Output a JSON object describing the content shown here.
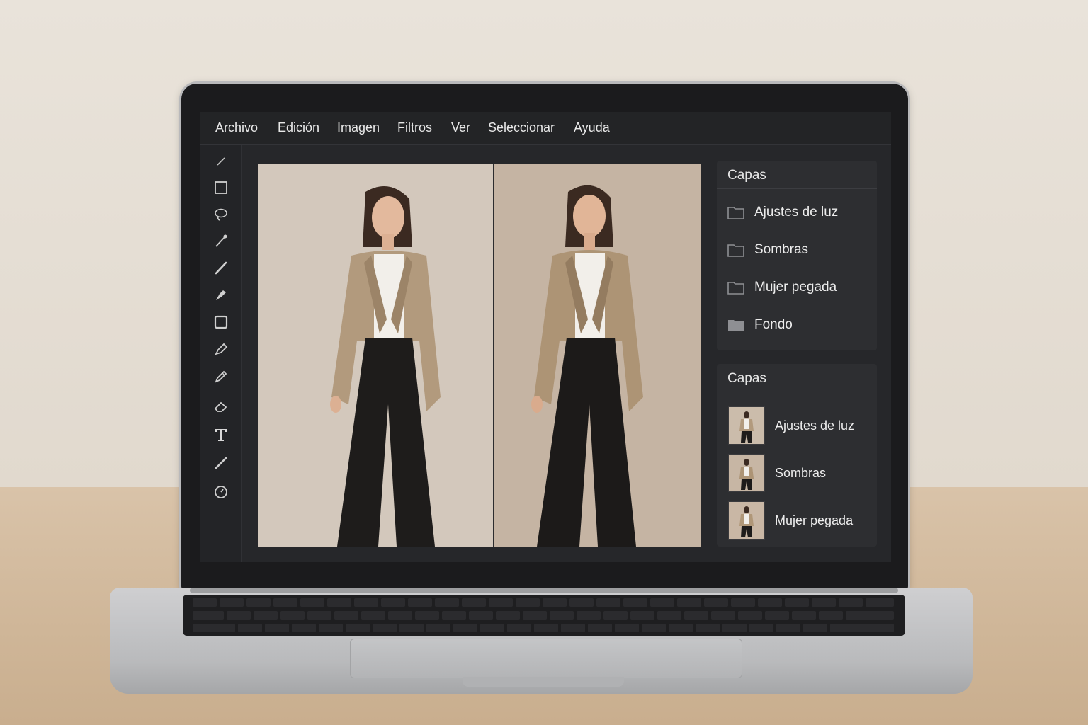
{
  "menubar": {
    "items": [
      {
        "label": "Archivo"
      },
      {
        "label": "Edición"
      },
      {
        "label": "Imagen"
      },
      {
        "label": "Filtros"
      },
      {
        "label": "Ver"
      },
      {
        "label": "Seleccionar"
      },
      {
        "label": "Ayuda"
      }
    ]
  },
  "tools": [
    {
      "icon": "line-icon"
    },
    {
      "icon": "rectangle-icon"
    },
    {
      "icon": "lasso-icon"
    },
    {
      "icon": "eyedropper-icon"
    },
    {
      "icon": "brush-icon"
    },
    {
      "icon": "pen-icon"
    },
    {
      "icon": "shape-icon"
    },
    {
      "icon": "marker-icon"
    },
    {
      "icon": "pencil-icon"
    },
    {
      "icon": "eraser-icon"
    },
    {
      "icon": "text-icon"
    },
    {
      "icon": "slash-icon"
    },
    {
      "icon": "clock-icon"
    }
  ],
  "panels": {
    "groups": {
      "title": "Capas",
      "items": [
        {
          "label": "Ajustes de luz"
        },
        {
          "label": "Sombras"
        },
        {
          "label": "Mujer pegada"
        },
        {
          "label": "Fondo"
        }
      ]
    },
    "layers": {
      "title": "Capas",
      "items": [
        {
          "label": "Ajustes de luz"
        },
        {
          "label": "Sombras"
        },
        {
          "label": "Mujer pegada"
        }
      ]
    }
  },
  "colors": {
    "ui_dark": "#26272a",
    "panel": "#2d2e31",
    "photo_bg_left": "#d3c8bc",
    "photo_bg_right": "#c5b4a3",
    "blazer": "#b29a7d",
    "trousers": "#1e1c1b"
  }
}
